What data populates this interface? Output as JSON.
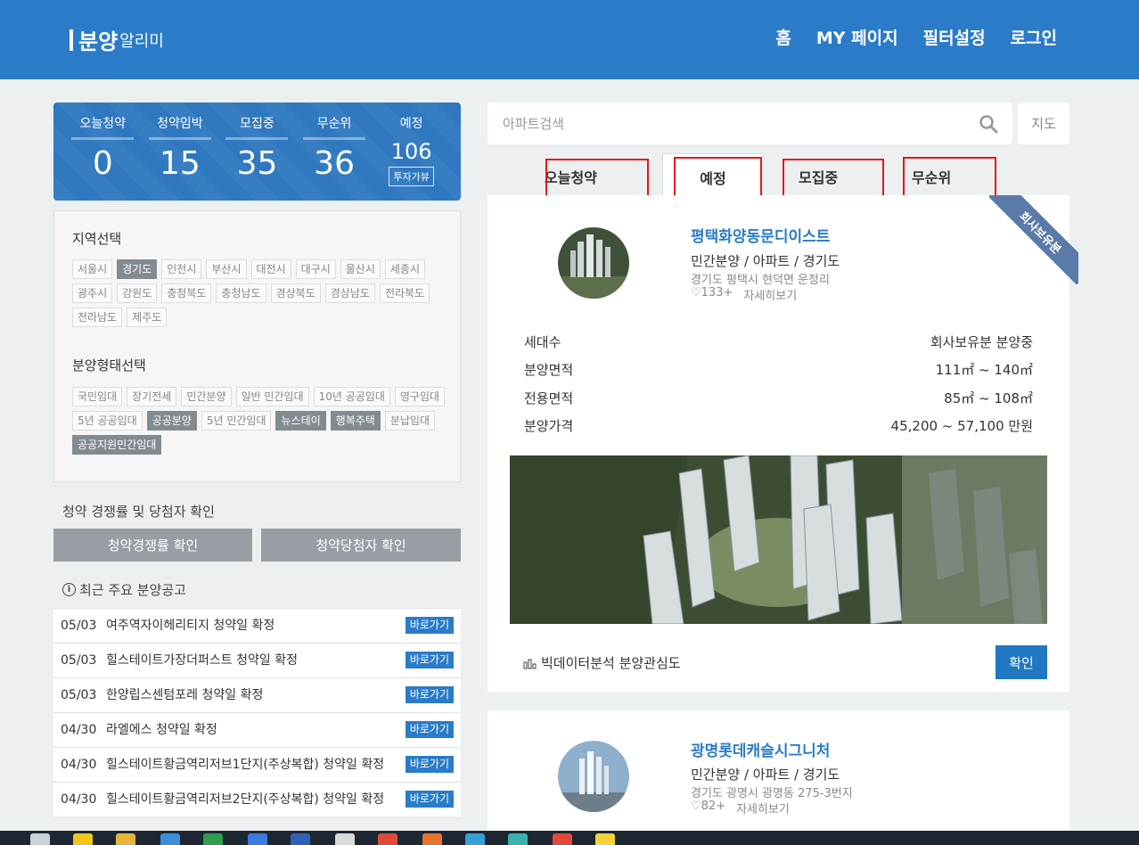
{
  "header": {
    "logo_main": "분양",
    "logo_sub": "알리미",
    "nav": [
      "홈",
      "MY 페이지",
      "필터설정",
      "로그인"
    ]
  },
  "stats": [
    {
      "label": "오늘청약",
      "value": "0"
    },
    {
      "label": "청약임박",
      "value": "15"
    },
    {
      "label": "모집중",
      "value": "35"
    },
    {
      "label": "무순위",
      "value": "36"
    },
    {
      "label": "예정",
      "value": "106",
      "button": "투자가뷰"
    }
  ],
  "filter": {
    "region_title": "지역선택",
    "regions": [
      "서울시",
      "경기도",
      "인천시",
      "부산시",
      "대전시",
      "대구시",
      "울산시",
      "세종시",
      "광주시",
      "강원도",
      "충청북도",
      "충청남도",
      "경상북도",
      "경상남도",
      "전라북도",
      "전라남도",
      "제주도"
    ],
    "region_selected": [
      "경기도"
    ],
    "type_title": "분양형태선택",
    "types": [
      "국민임대",
      "장기전세",
      "민간분양",
      "일반 민간임대",
      "10년 공공임대",
      "영구임대",
      "5년 공공임대",
      "공공분양",
      "5년 민간임대",
      "뉴스테이",
      "행복주택",
      "분납임대",
      "공공지원민간임대"
    ],
    "type_selected": [
      "공공분양",
      "뉴스테이",
      "행복주택",
      "공공지원민간임대"
    ]
  },
  "competition": {
    "title": "청약 경쟁률 및 당첨자 확인",
    "btn1": "청약경쟁률 확인",
    "btn2": "청약당첨자 확인"
  },
  "notices": {
    "title": "최근 주요 분양공고",
    "go_label": "바로가기",
    "items": [
      {
        "date": "05/03",
        "text": "여주역자이헤리티지 청약일 확정"
      },
      {
        "date": "05/03",
        "text": "힐스테이트가장더퍼스트 청약일 확정"
      },
      {
        "date": "05/03",
        "text": "한양립스센텀포레 청약일 확정"
      },
      {
        "date": "04/30",
        "text": "라엘에스 청약일 확정"
      },
      {
        "date": "04/30",
        "text": "힐스테이트황금역리저브1단지(주상복합) 청약일 확정"
      },
      {
        "date": "04/30",
        "text": "힐스테이트황금역리저브2단지(주상복합) 청약일 확정"
      }
    ]
  },
  "search": {
    "placeholder": "아파트검색",
    "map_label": "지도"
  },
  "tabs": [
    "오늘청약",
    "예정",
    "모집중",
    "무순위"
  ],
  "cards": [
    {
      "title": "평택화양동문디이스트",
      "type": "민간분양 / 아파트 / 경기도",
      "address": "경기도 평택시 현덕면 운정리",
      "likes": "133+",
      "detail": "자세히보기",
      "ribbon": "회사보유분",
      "rows": [
        {
          "label": "세대수",
          "value": "회사보유분 분양중"
        },
        {
          "label": "분양면적",
          "value": "111㎡ ~ 140㎡"
        },
        {
          "label": "전용면적",
          "value": "85㎡ ~ 108㎡"
        },
        {
          "label": "분양가격",
          "value": "45,200 ~ 57,100 만원"
        }
      ],
      "bigdata": "빅데이터분석 분양관심도",
      "confirm": "확인"
    },
    {
      "title": "광명롯데캐슬시그니처",
      "type": "민간분양 / 아파트 / 경기도",
      "address": "경기도 광명시 광명동 275-3번지",
      "likes": "82+",
      "detail": "자세히보기"
    }
  ]
}
